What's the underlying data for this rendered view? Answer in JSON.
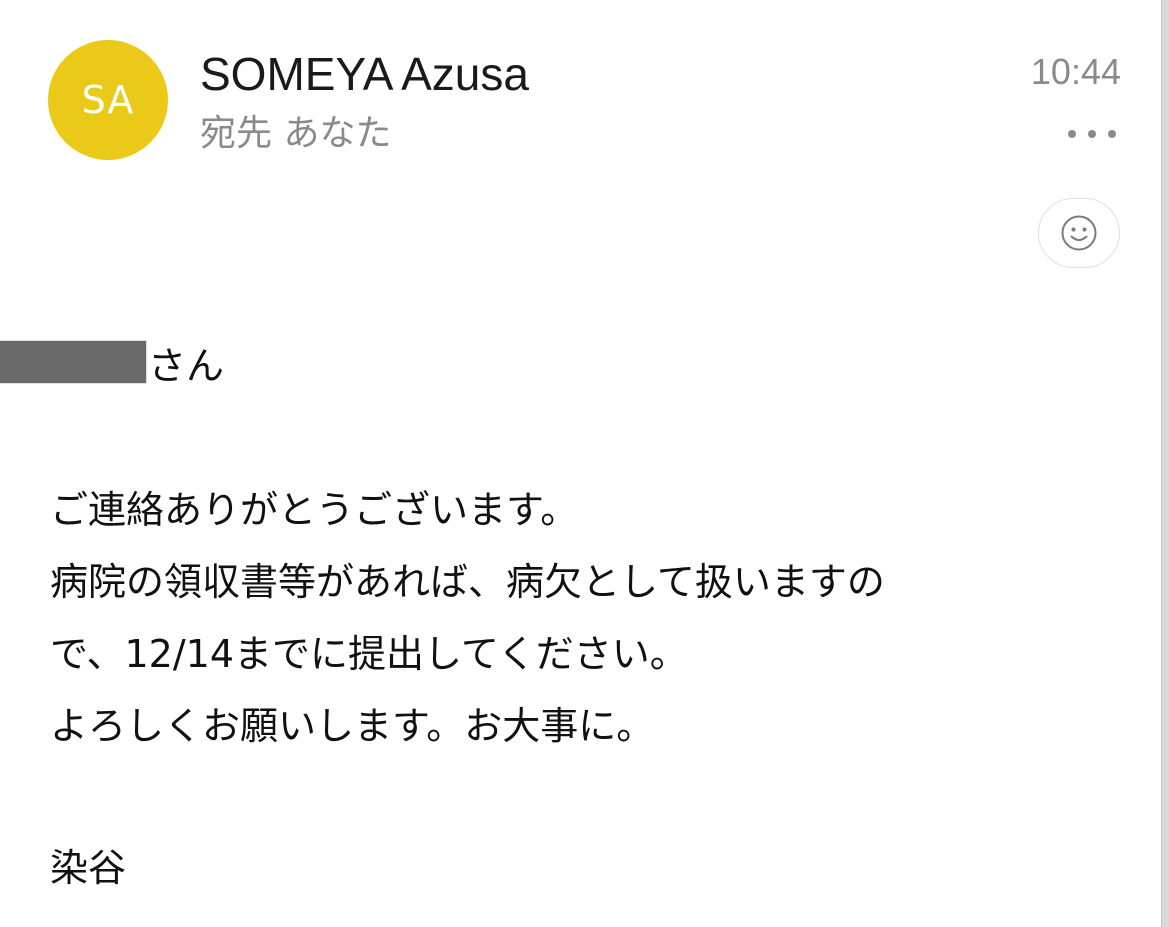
{
  "header": {
    "avatar_initials": "SA",
    "avatar_color": "#ebc918",
    "sender_name": "SOMEYA Azusa",
    "recipient_line": "宛先 あなた",
    "time": "10:44",
    "more_icon": "ellipsis-icon",
    "reaction_icon": "smiley-icon"
  },
  "message": {
    "greeting_suffix": "さん",
    "lines": [
      "ご連絡ありがとうございます。",
      "病院の領収書等があれば、病欠として扱いますの",
      "で、12/14までに提出してください。",
      "よろしくお願いします。お大事に。"
    ],
    "signature": "染谷"
  }
}
